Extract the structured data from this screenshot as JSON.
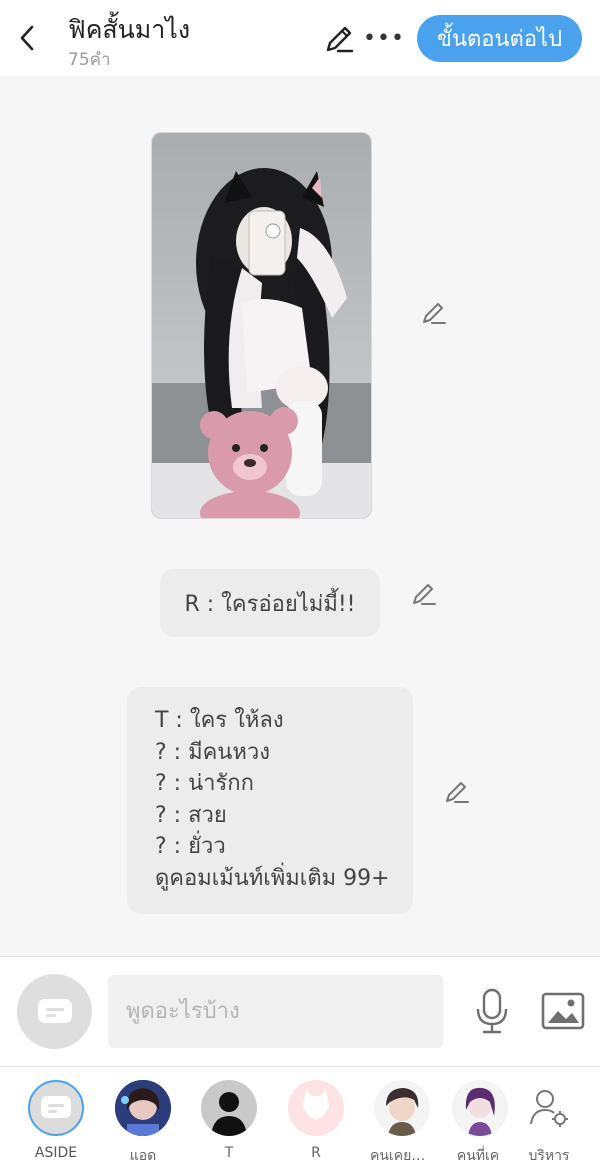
{
  "header": {
    "title": "ฟิคสั้นมาไง",
    "word_count": "75คำ",
    "next_label": "ขั้นตอนต่อไป",
    "more_label": "•••"
  },
  "messages": {
    "bubble1": "R : ใครอ่อยไม่มี้!!",
    "bubble2_lines": [
      "T : ใคร ให้ลง",
      "? : มีคนหวง",
      "? : น่ารักก",
      "? : สวย",
      "? : ยั่วว",
      "ดูคอมเม้นท์เพิ่มเติม 99+"
    ]
  },
  "input": {
    "placeholder": "พูดอะไรบ้าง"
  },
  "nav": [
    {
      "label": "ASIDE",
      "icon": "aside-icon"
    },
    {
      "label": "แอด",
      "icon": "avatar-photo"
    },
    {
      "label": "T",
      "icon": "person-silhouette-icon"
    },
    {
      "label": "R",
      "icon": "cat-icon"
    },
    {
      "label": "คนเคยชี้...",
      "icon": "avatar-illustration"
    },
    {
      "label": "คนที่เค",
      "icon": "avatar-illustration"
    },
    {
      "label": "บริหาร",
      "icon": "user-settings-icon"
    }
  ],
  "colors": {
    "accent": "#4aa2ef",
    "bubble": "#ececec",
    "background": "#f6f6f6"
  }
}
